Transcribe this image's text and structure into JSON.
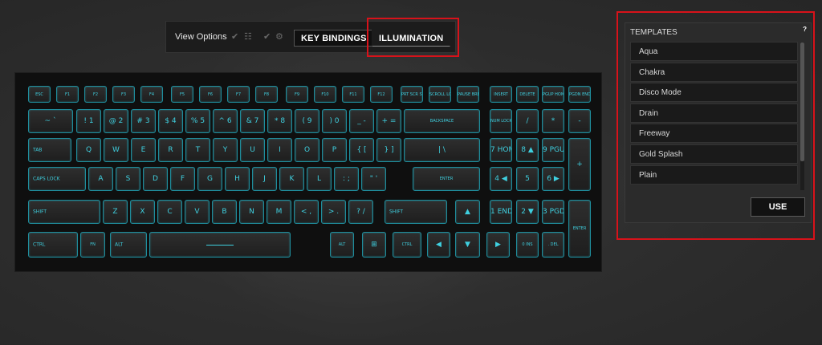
{
  "toolbar": {
    "view_options": "View Options",
    "icons": [
      "check-icon",
      "list-icon",
      "check-icon",
      "gear-icon"
    ],
    "key_bindings": "KEY BINDINGS",
    "illumination": "ILLUMINATION"
  },
  "keyboard": {
    "row_fn": [
      "ESC",
      "F1",
      "F2",
      "F3",
      "F4",
      "F5",
      "F6",
      "F7",
      "F8",
      "F9",
      "F10",
      "F11",
      "F12",
      "PRT SCR SYS RQ",
      "SCROLL LOCK",
      "PAUSE BREAK",
      "INSERT",
      "DELETE",
      "PGUP HOME",
      "PGDN END"
    ],
    "row_num": [
      "~ `",
      "! 1",
      "@ 2",
      "# 3",
      "$ 4",
      "% 5",
      "^ 6",
      "& 7",
      "* 8",
      "( 9",
      ") 0",
      "_ -",
      "+ =",
      "BACKSPACE",
      "NUM LOCK",
      "/",
      "*",
      "-"
    ],
    "row_tab": [
      "TAB",
      "Q",
      "W",
      "E",
      "R",
      "T",
      "Y",
      "U",
      "I",
      "O",
      "P",
      "{ [",
      "} ]",
      "| \\",
      "7 HOME",
      "8 ▲",
      "9 PGUP",
      "+"
    ],
    "row_caps": [
      "CAPS LOCK",
      "A",
      "S",
      "D",
      "F",
      "G",
      "H",
      "J",
      "K",
      "L",
      ": ;",
      "\" '",
      "ENTER",
      "4 ◀",
      "5",
      "6 ▶"
    ],
    "row_shift": [
      "SHIFT",
      "Z",
      "X",
      "C",
      "V",
      "B",
      "N",
      "M",
      "< ,",
      "> .",
      "? /",
      "SHIFT",
      "▲",
      "1 END",
      "2 ▼",
      "3 PGDN",
      "ENTER"
    ],
    "row_ctrl": [
      "CTRL",
      "FN",
      "ALT",
      "",
      "ALT",
      "⊞",
      "CTRL",
      "◀",
      "▼",
      "▶",
      "0 INS",
      ". DEL"
    ]
  },
  "templates": {
    "title": "TEMPLATES",
    "help": "?",
    "items": [
      "Aqua",
      "Chakra",
      "Disco Mode",
      "Drain",
      "Freeway",
      "Gold Splash",
      "Plain"
    ],
    "use_label": "USE"
  },
  "colors": {
    "accent_highlight": "#d8121a",
    "key_glow": "#3fd0e0"
  }
}
